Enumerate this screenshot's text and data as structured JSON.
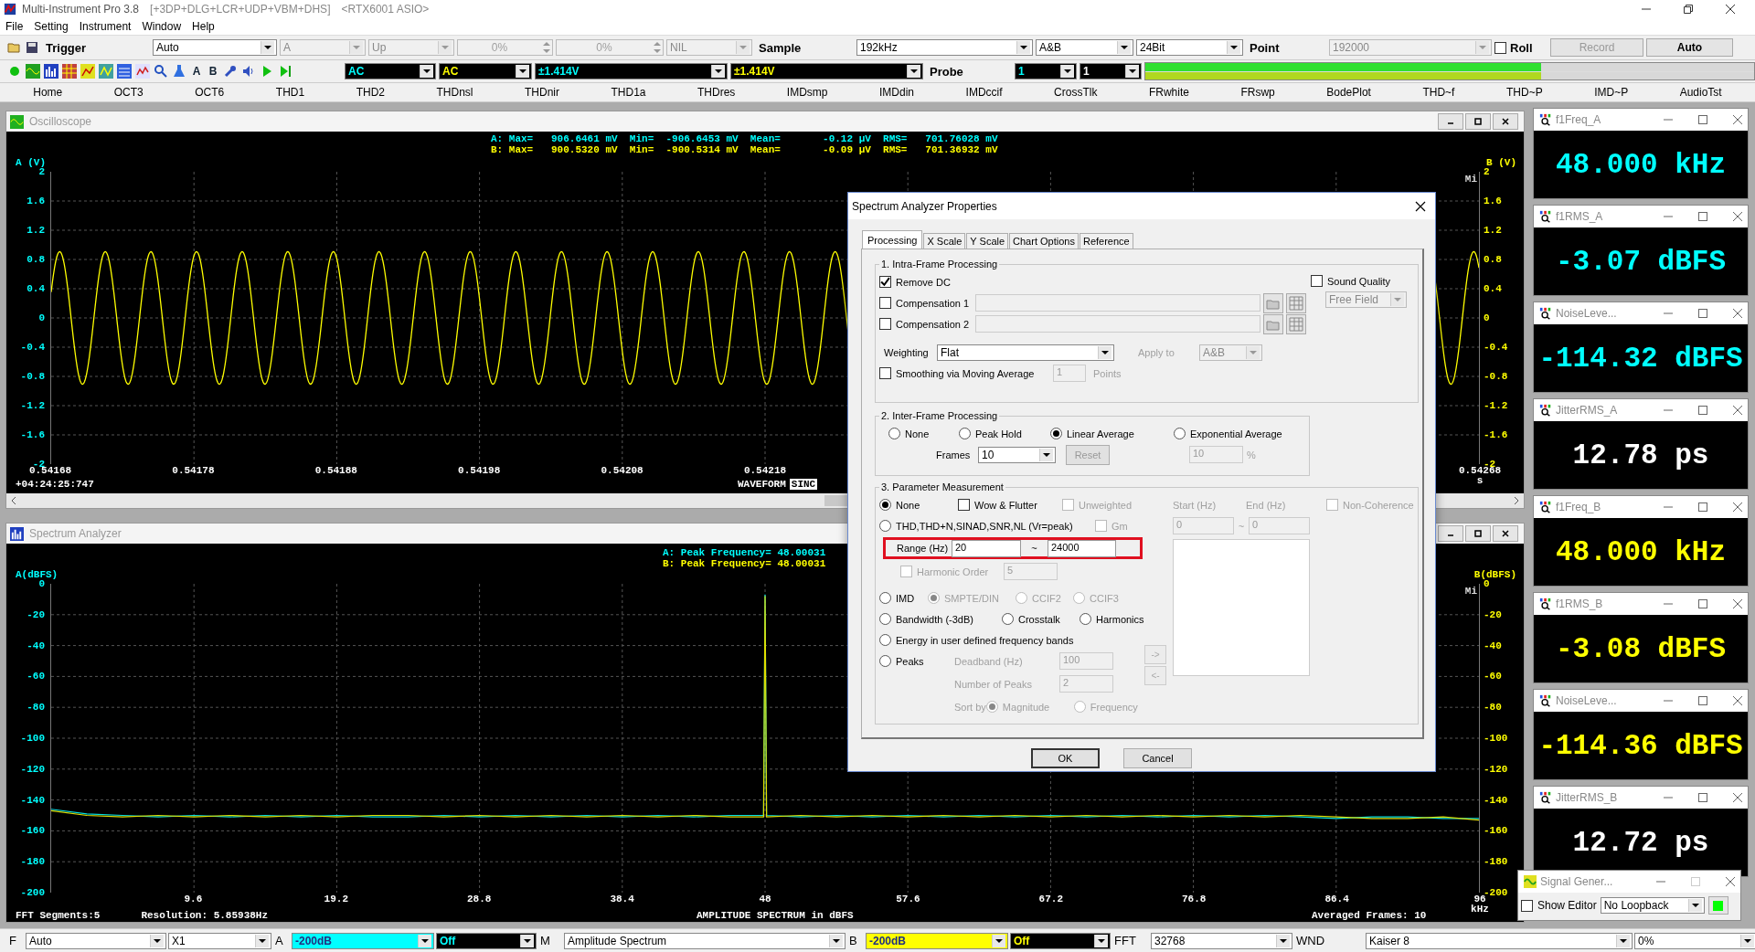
{
  "app": {
    "title": "Multi-Instrument Pro 3.8",
    "subtitle": "[+3DP+DLG+LCR+UDP+VBM+DHS]",
    "device": "<RTX6001 ASIO>"
  },
  "menu": [
    "File",
    "Setting",
    "Instrument",
    "Window",
    "Help"
  ],
  "toolbar": [
    {
      "kind": "label",
      "text": "Trigger"
    },
    {
      "kind": "select",
      "value": "Auto",
      "disabled": false
    },
    {
      "kind": "select",
      "value": "A",
      "disabled": true
    },
    {
      "kind": "select",
      "value": "Up",
      "disabled": true
    },
    {
      "kind": "spin",
      "value": "0%",
      "disabled": true
    },
    {
      "kind": "spin",
      "value": "0%",
      "disabled": true
    },
    {
      "kind": "select",
      "value": "NIL",
      "disabled": true
    },
    {
      "kind": "label",
      "text": "Sample"
    },
    {
      "kind": "select",
      "value": "192kHz",
      "disabled": false
    },
    {
      "kind": "select",
      "value": "A&B",
      "disabled": false
    },
    {
      "kind": "select",
      "value": "24Bit",
      "disabled": false
    },
    {
      "kind": "label",
      "text": "Point"
    },
    {
      "kind": "select",
      "value": "192000",
      "disabled": true
    },
    {
      "kind": "check",
      "text": "Roll",
      "checked": false
    },
    {
      "kind": "button",
      "text": "Record",
      "disabled": true
    },
    {
      "kind": "button",
      "text": "Auto",
      "disabled": false
    }
  ],
  "toolbar2": {
    "letter_tools": [
      "A",
      "B"
    ],
    "items": [
      {
        "kind": "channel_a",
        "value": "AC"
      },
      {
        "kind": "channel_b",
        "value": "AC"
      },
      {
        "kind": "channel_a",
        "value": "±1.414V"
      },
      {
        "kind": "channel_b",
        "value": "±1.414V"
      },
      {
        "kind": "label",
        "text": "Probe"
      },
      {
        "kind": "channel_a",
        "value": "1"
      },
      {
        "kind": "plain",
        "value": "1"
      }
    ],
    "meter": [
      {
        "level": 0.65
      },
      {
        "level": 0.65
      }
    ]
  },
  "instrument_tabs": [
    "Home",
    "OCT3",
    "OCT6",
    "THD1",
    "THD2",
    "THDnsl",
    "THDnir",
    "THD1a",
    "THDres",
    "IMDsmp",
    "IMDdin",
    "IMDccif",
    "CrossTlk",
    "FRwhite",
    "FRswp",
    "BodePlot",
    "THD~f",
    "THD~P",
    "IMD~P",
    "AudioTst"
  ],
  "oscilloscope": {
    "title": "Oscilloscope",
    "left_unit": "A (V)",
    "right_unit": "B (V)",
    "stats": [
      "A: Max=   906.6461 mV  Min=  -906.6453 mV  Mean=       -0.12 µV  RMS=   701.76028 mV",
      "B: Max=   900.5320 mV  Min=  -900.5314 mV  Mean=       -0.09 µV  RMS=   701.36932 mV"
    ],
    "corner": "Mi",
    "y_labels": [
      "2",
      "1.6",
      "1.2",
      "0.8",
      "0.4",
      "0",
      "-0.4",
      "-0.8",
      "-1.2",
      "-1.6",
      "-2"
    ],
    "right_y_labels": [
      "2",
      "1.6",
      "1.2",
      "0.8",
      "0.4",
      "0",
      "-0.4",
      "-0.8",
      "-1.2",
      "-1.6",
      "-2"
    ],
    "x_labels": [
      "0.54168",
      "0.54178",
      "0.54188",
      "0.54198",
      "0.54208",
      "0.54218",
      "0.54268"
    ],
    "x_unit": "s",
    "timestamp": "+04:24:25:747",
    "mode": "WAVEFORM",
    "filter": "SINC"
  },
  "spectrum": {
    "title": "Spectrum Analyzer",
    "left_unit": "A(dBFS)",
    "right_unit": "B(dBFS)",
    "peaks": [
      "A: Peak Frequency= 48.00031",
      "B: Peak Frequency= 48.00031"
    ],
    "corner": "Mi",
    "right_y_labels": [
      "0",
      "-20",
      "-40",
      "-60",
      "-80",
      "-100",
      "-120",
      "-140",
      "-160",
      "-180",
      "-200"
    ],
    "chart_data": {
      "type": "line",
      "grid": true,
      "xlim": [
        0,
        96
      ],
      "ylim": [
        -200,
        0
      ],
      "xticks": [
        9.6,
        19.2,
        28.8,
        38.4,
        48,
        57.6,
        67.2,
        76.8,
        86.4,
        96
      ],
      "yticks": [
        0,
        -20,
        -40,
        -60,
        -80,
        -100,
        -120,
        -140,
        -160,
        -180,
        -200
      ],
      "x": [
        0,
        2.4,
        4.8,
        7.2,
        9.6,
        12,
        14.4,
        16.8,
        19.2,
        21.6,
        24,
        26.4,
        28.8,
        31.2,
        33.6,
        36,
        38.4,
        40.8,
        43.2,
        45.6,
        47.9,
        48,
        48.1,
        50.4,
        52.8,
        55.2,
        57.6,
        60,
        62.4,
        64.8,
        67.2,
        69.6,
        72,
        74.4,
        76.8,
        79.2,
        81.6,
        84,
        86.4,
        88.8,
        91.2,
        93.6,
        96
      ],
      "series": [
        {
          "color": "#00e0e0",
          "values": [
            -146,
            -149,
            -150,
            -151,
            -150,
            -151,
            -150,
            -151,
            -150,
            -151,
            -151,
            -150,
            -151,
            -150,
            -151,
            -150,
            -151,
            -150,
            -151,
            -150,
            -150,
            -7,
            -150,
            -151,
            -150,
            -151,
            -150,
            -151,
            -150,
            -151,
            -150,
            -151,
            -150,
            -151,
            -150,
            -151,
            -150,
            -151,
            -152,
            -151,
            -151,
            -152,
            -152
          ]
        },
        {
          "color": "#e0e000",
          "values": [
            -147,
            -150,
            -151,
            -150,
            -151,
            -150,
            -151,
            -150,
            -151,
            -150,
            -150,
            -151,
            -150,
            -151,
            -150,
            -151,
            -150,
            -151,
            -150,
            -151,
            -151,
            -8,
            -151,
            -150,
            -151,
            -150,
            -151,
            -150,
            -151,
            -150,
            -151,
            -150,
            -151,
            -150,
            -151,
            -150,
            -151,
            -150,
            -151,
            -152,
            -152,
            -151,
            -153
          ]
        }
      ]
    },
    "x_unit": "kHz",
    "segments": "FFT Segments:5",
    "resolution": "Resolution: 5.85938Hz",
    "caption": "AMPLITUDE SPECTRUM in dBFS",
    "frames": "Averaged Frames: 10"
  },
  "dialog": {
    "title": "Spectrum Analyzer Properties",
    "tabs": [
      {
        "label": "Processing",
        "selected": true
      },
      {
        "label": "X Scale",
        "selected": false
      },
      {
        "label": "Y Scale",
        "selected": false
      },
      {
        "label": "Chart Options",
        "selected": false
      },
      {
        "label": "Reference",
        "selected": false
      }
    ],
    "intra": {
      "title": "1. Intra-Frame Processing",
      "remove_dc": {
        "label": "Remove DC",
        "checked": true
      },
      "compensation": [
        {
          "label": "Compensation 1",
          "checked": false
        },
        {
          "label": "Compensation 2",
          "checked": false
        }
      ],
      "weighting": {
        "label": "Weighting",
        "value": "Flat"
      },
      "apply_to": {
        "label": "Apply to",
        "value": "A&B",
        "disabled": true
      },
      "smoothing": {
        "label": "Smoothing via Moving Average",
        "checked": false,
        "value": "1",
        "unit": "Points"
      },
      "sound_quality": {
        "label": "Sound Quality",
        "checked": false,
        "value": "Free Field"
      }
    },
    "inter": {
      "title": "2. Inter-Frame Processing",
      "modes": [
        {
          "label": "None",
          "selected": false
        },
        {
          "label": "Peak Hold",
          "selected": false
        },
        {
          "label": "Linear Average",
          "selected": true
        },
        {
          "label": "Exponential Average",
          "selected": false
        }
      ],
      "frames": {
        "label": "Frames",
        "value": "10"
      },
      "reset": "Reset",
      "factor": "10",
      "factor_unit": "%"
    },
    "measure": {
      "title": "3. Parameter Measurement",
      "modes": [
        {
          "label": "None",
          "selected": true
        },
        {
          "label": "THD,THD+N,SINAD,SNR,NL (Vr=peak)",
          "selected": false
        },
        {
          "label": "IMD",
          "selected": false
        },
        {
          "label": "Bandwidth (-3dB)",
          "selected": false
        },
        {
          "label": "Crosstalk",
          "selected": false
        },
        {
          "label": "Harmonics",
          "selected": false
        },
        {
          "label": "Energy in user defined frequency bands",
          "selected": false
        },
        {
          "label": "Peaks",
          "selected": false
        }
      ],
      "wow_flutter": {
        "label": "Wow & Flutter",
        "checked": false
      },
      "unweighted": {
        "label": "Unweighted",
        "checked": false
      },
      "gm": {
        "label": "Gm",
        "checked": false
      },
      "non_coherence": {
        "label": "Non-Coherence",
        "checked": false
      },
      "band_start": {
        "label": "Start (Hz)",
        "value": "0"
      },
      "band_end": {
        "label": "End (Hz)",
        "value": "0"
      },
      "band_sep": "~",
      "range": {
        "label": "Range (Hz)",
        "from": "20",
        "sep": "~",
        "to": "24000",
        "highlighted": true
      },
      "harmonic_order": {
        "label": "Harmonic Order",
        "checked": false,
        "value": "5"
      },
      "imd_types": [
        {
          "label": "SMPTE/DIN",
          "selected": true
        },
        {
          "label": "CCIF2",
          "selected": false
        },
        {
          "label": "CCIF3",
          "selected": false
        }
      ],
      "deadband": {
        "label": "Deadband (Hz)",
        "value": "100"
      },
      "num_peaks": {
        "label": "Number of Peaks",
        "value": "2"
      },
      "sort_by": {
        "label": "Sort by",
        "options": [
          {
            "label": "Magnitude",
            "selected": true
          },
          {
            "label": "Frequency",
            "selected": false
          }
        ]
      },
      "move_buttons": [
        "->",
        "<-"
      ]
    },
    "buttons": [
      "OK",
      "Cancel"
    ]
  },
  "meters": [
    {
      "title": "f1Freq_A",
      "value": "48.000 kHz",
      "color": "#00ffff"
    },
    {
      "title": "f1RMS_A",
      "value": "-3.07 dBFS",
      "color": "#00ffff"
    },
    {
      "title": "NoiseLeve...",
      "value": "-114.32 dBFS",
      "color": "#00ffff"
    },
    {
      "title": "JitterRMS_A",
      "value": "12.78 ps",
      "color": "#ffffff"
    },
    {
      "title": "f1Freq_B",
      "value": "48.000 kHz",
      "color": "#ffff00"
    },
    {
      "title": "f1RMS_B",
      "value": "-3.08 dBFS",
      "color": "#ffff00"
    },
    {
      "title": "NoiseLeve...",
      "value": "-114.36 dBFS",
      "color": "#ffff00"
    },
    {
      "title": "JitterRMS_B",
      "value": "12.72 ps",
      "color": "#ffffff"
    }
  ],
  "signal_generator": {
    "title": "Signal Gener...",
    "show_editor": {
      "label": "Show Editor",
      "checked": false
    },
    "loopback": "No Loopback",
    "on": true
  },
  "bottom_bar": [
    {
      "kind": "label",
      "text": "F"
    },
    {
      "kind": "select",
      "value": "Auto"
    },
    {
      "kind": "select",
      "value": "X1"
    },
    {
      "kind": "label",
      "text": "A"
    },
    {
      "kind": "filled",
      "value": "-200dB",
      "color": "#00ffff"
    },
    {
      "kind": "dark_a",
      "value": "Off"
    },
    {
      "kind": "label",
      "text": "M"
    },
    {
      "kind": "select",
      "value": "Amplitude Spectrum"
    },
    {
      "kind": "label",
      "text": "B"
    },
    {
      "kind": "filled",
      "value": "-200dB",
      "color": "#ffff00"
    },
    {
      "kind": "dark_b",
      "value": "Off"
    },
    {
      "kind": "label",
      "text": "FFT"
    },
    {
      "kind": "select",
      "value": "32768"
    },
    {
      "kind": "label",
      "text": "WND"
    },
    {
      "kind": "select",
      "value": "Kaiser 8"
    },
    {
      "kind": "select",
      "value": "0%"
    }
  ]
}
